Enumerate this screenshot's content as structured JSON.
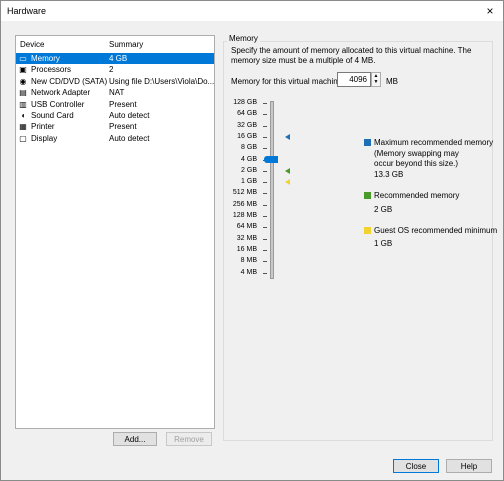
{
  "window": {
    "title": "Hardware",
    "close_icon": "×"
  },
  "devices": {
    "columns": [
      "Device",
      "Summary"
    ],
    "rows": [
      {
        "icon": "memory-icon",
        "glyph": "▭",
        "name": "Memory",
        "summary": "4 GB",
        "selected": true
      },
      {
        "icon": "processor-icon",
        "glyph": "▣",
        "name": "Processors",
        "summary": "2"
      },
      {
        "icon": "cd-dvd-icon",
        "glyph": "◉",
        "name": "New CD/DVD (SATA)",
        "summary": "Using file D:\\Users\\Viola\\Do..."
      },
      {
        "icon": "network-icon",
        "glyph": "▤",
        "name": "Network Adapter",
        "summary": "NAT"
      },
      {
        "icon": "usb-icon",
        "glyph": "▥",
        "name": "USB Controller",
        "summary": "Present"
      },
      {
        "icon": "sound-icon",
        "glyph": "◖",
        "name": "Sound Card",
        "summary": "Auto detect"
      },
      {
        "icon": "printer-icon",
        "glyph": "▦",
        "name": "Printer",
        "summary": "Present"
      },
      {
        "icon": "display-icon",
        "glyph": "▢",
        "name": "Display",
        "summary": "Auto detect"
      }
    ],
    "add_label": "Add...",
    "remove_label": "Remove"
  },
  "memory": {
    "group_title": "Memory",
    "description": "Specify the amount of memory allocated to this virtual machine. The memory size must be a multiple of 4 MB.",
    "field_label": "Memory for this virtual machine:",
    "value": "4096",
    "unit": "MB",
    "scale_labels": [
      "128 GB",
      "64 GB",
      "32 GB",
      "16 GB",
      "8 GB",
      "4 GB",
      "2 GB",
      "1 GB",
      "512 MB",
      "256 MB",
      "128 MB",
      "64 MB",
      "32 MB",
      "16 MB",
      "8 MB",
      "4 MB"
    ],
    "selected_index": 5,
    "max_recommended_index": 3,
    "recommended_index": 6,
    "guest_min_index": 7,
    "legend": {
      "max_title": "Maximum recommended memory",
      "max_note": "(Memory swapping may occur beyond this size.)",
      "max_value": "13.3 GB",
      "rec_title": "Recommended memory",
      "rec_value": "2 GB",
      "min_title": "Guest OS recommended minimum",
      "min_value": "1 GB"
    },
    "colors": {
      "max": "#1f6fb5",
      "rec": "#4a9a2a",
      "min": "#f2d22e"
    }
  },
  "footer": {
    "close_label": "Close",
    "help_label": "Help"
  }
}
